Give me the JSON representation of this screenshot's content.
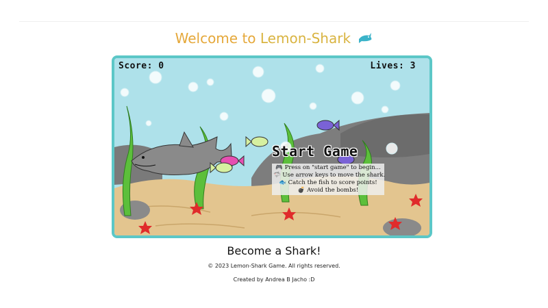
{
  "header": {
    "title_welcome": "Welcome to ",
    "title_brand": "Lemon-Shark",
    "title_icon": "shark-icon"
  },
  "game": {
    "score_label": "Score:",
    "score_value": "0",
    "lives_label": "Lives:",
    "lives_value": "3",
    "start_label": "Start Game",
    "instructions": [
      {
        "icon": "gamepad-icon",
        "text": "Press on \"start game\" to begin..."
      },
      {
        "icon": "shark-icon",
        "text": "Use arrow keys to move the shark."
      },
      {
        "icon": "fish-icon",
        "text": "Catch the fish to score points!"
      },
      {
        "icon": "bomb-icon",
        "text": "Avoid the bombs!"
      }
    ]
  },
  "footer": {
    "subtitle": "Become a Shark!",
    "copyright": "© 2023 Lemon-Shark Game. All rights reserved.",
    "credits": "Created by Andrea B Jacho :D"
  },
  "colors": {
    "frame_border": "#5cc7c7",
    "water": "#aee1ea",
    "sand": "#e3c58f",
    "title_orange": "#e5a83a",
    "title_gold": "#d9b441"
  }
}
